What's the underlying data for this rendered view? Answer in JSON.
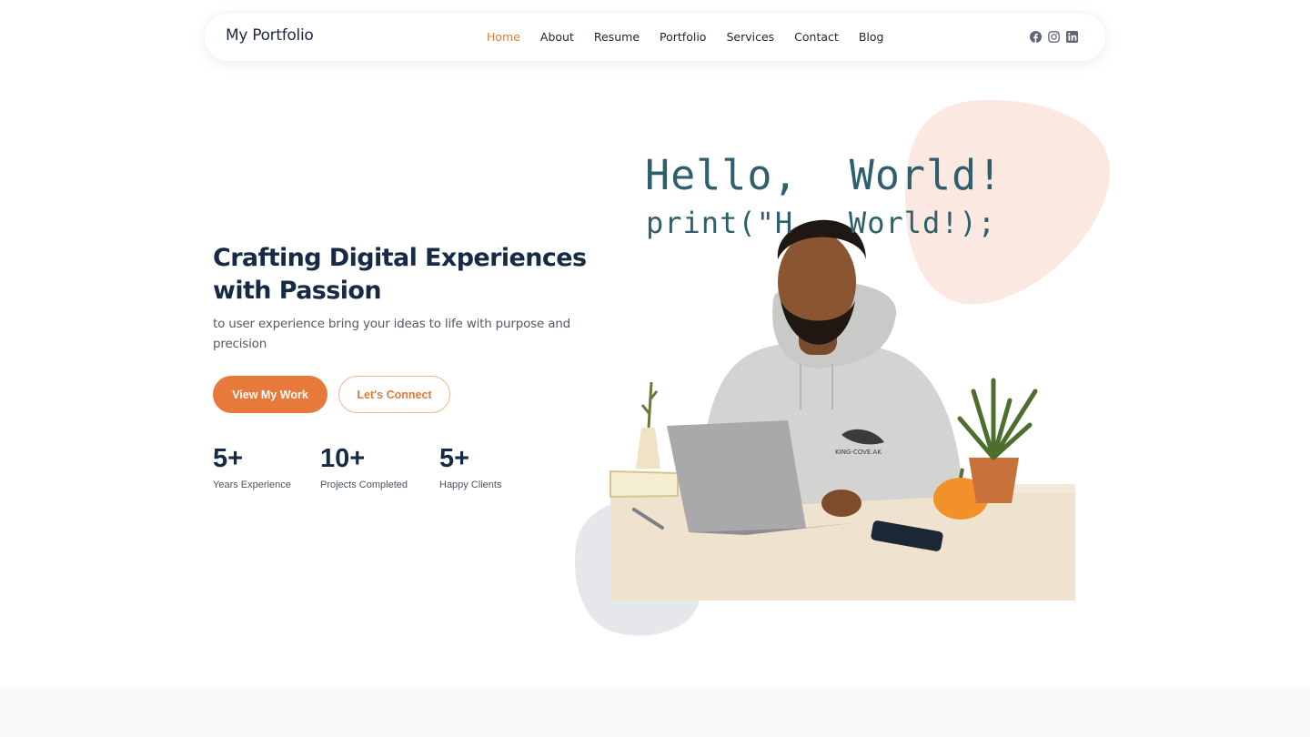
{
  "header": {
    "logo": "My Portfolio",
    "nav": [
      "Home",
      "About",
      "Resume",
      "Portfolio",
      "Services",
      "Contact",
      "Blog"
    ],
    "active_nav": "Home",
    "socials": [
      "facebook-icon",
      "instagram-icon",
      "linkedin-icon"
    ]
  },
  "hero": {
    "title": "Crafting Digital Experiences with Passion",
    "subtitle": "to user experience bring your ideas to life with purpose and precision",
    "primary_button": "View My Work",
    "secondary_button": "Let's Connect",
    "stats": [
      {
        "value": "5+",
        "label": "Years Experience"
      },
      {
        "value": "10+",
        "label": "Projects Completed"
      },
      {
        "value": "5+",
        "label": "Happy Clients"
      }
    ],
    "image": {
      "code_line_1": "Hello,  World!",
      "code_line_2": "print(\"H   World!);",
      "hoodie_text": "KING-COVE.AK"
    }
  },
  "colors": {
    "accent": "#e77a3a",
    "heading": "#172a45",
    "blob_peach": "#fbe9e1",
    "blob_gray": "#e5e7eb"
  }
}
